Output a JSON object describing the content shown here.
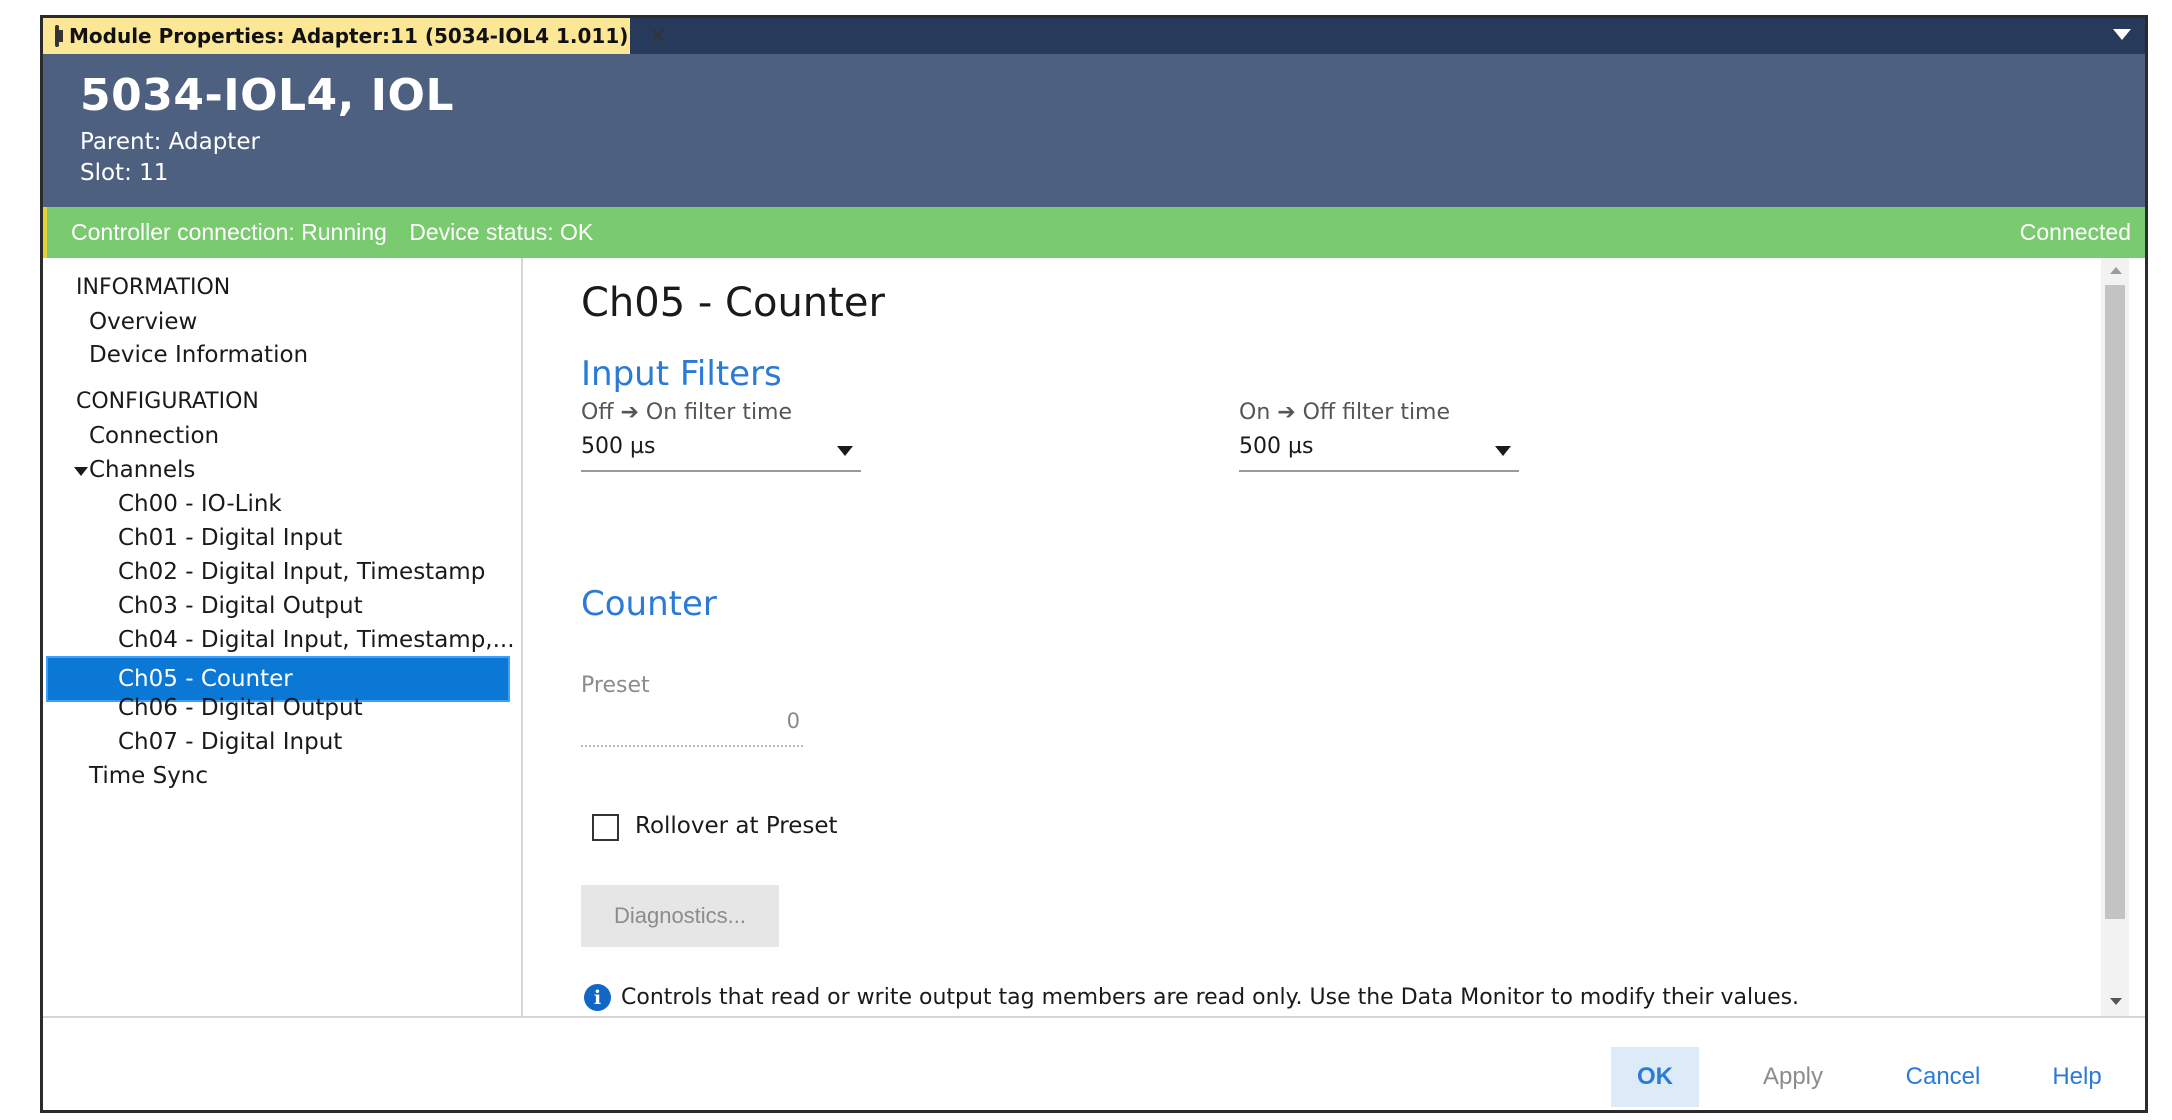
{
  "titlebar": {
    "tab_title": "Module Properties:  Adapter:11 (5034-IOL4 1.011)",
    "close_glyph": "✕",
    "tab_icon": "module-document-icon",
    "dropdown_icon": "chevron-down-icon"
  },
  "header": {
    "module_name": "5034-IOL4, IOL",
    "parent": "Parent:  Adapter",
    "slot": "Slot:  11"
  },
  "status": {
    "controller_connection": "Controller connection: Running",
    "device_status": "Device status: OK",
    "connection_state": "Connected",
    "bar_color": "#7acb6f",
    "accent_color": "#e4d13a"
  },
  "sidebar": {
    "information_heading": "INFORMATION",
    "overview": "Overview",
    "device_information": "Device Information",
    "configuration_heading": "CONFIGURATION",
    "connection": "Connection",
    "channels": "Channels",
    "channel_items": [
      "Ch00 - IO-Link",
      "Ch01 - Digital Input",
      "Ch02 - Digital Input, Timestamp",
      "Ch03 - Digital Output",
      "Ch04 - Digital Input, Timestamp,...",
      "Ch05 - Counter",
      "Ch06 - Digital Output",
      "Ch07 - Digital Input"
    ],
    "selected_index": 5,
    "time_sync": "Time Sync"
  },
  "content": {
    "page_title": "Ch05 - Counter",
    "input_filters_title": "Input Filters",
    "off_on_label": "Off ➔ On filter time",
    "off_on_value": "500 µs",
    "on_off_label": "On ➔ Off filter time",
    "on_off_value": "500 µs",
    "counter_title": "Counter",
    "preset_label": "Preset",
    "preset_value": "0",
    "rollover_label": "Rollover at Preset",
    "rollover_checked": false,
    "diagnostics_label": "Diagnostics...",
    "info_text": "Controls that read or write output tag members are read only. Use the Data Monitor to modify their values.",
    "info_glyph": "i"
  },
  "footer": {
    "ok": "OK",
    "apply": "Apply",
    "cancel": "Cancel",
    "help": "Help"
  },
  "colors": {
    "header_bg": "#4e607f",
    "titlebar_bg": "#283a5c",
    "tab_bg": "#fbe796",
    "selection": "#0a78d4",
    "link_blue": "#2b7ad6"
  }
}
